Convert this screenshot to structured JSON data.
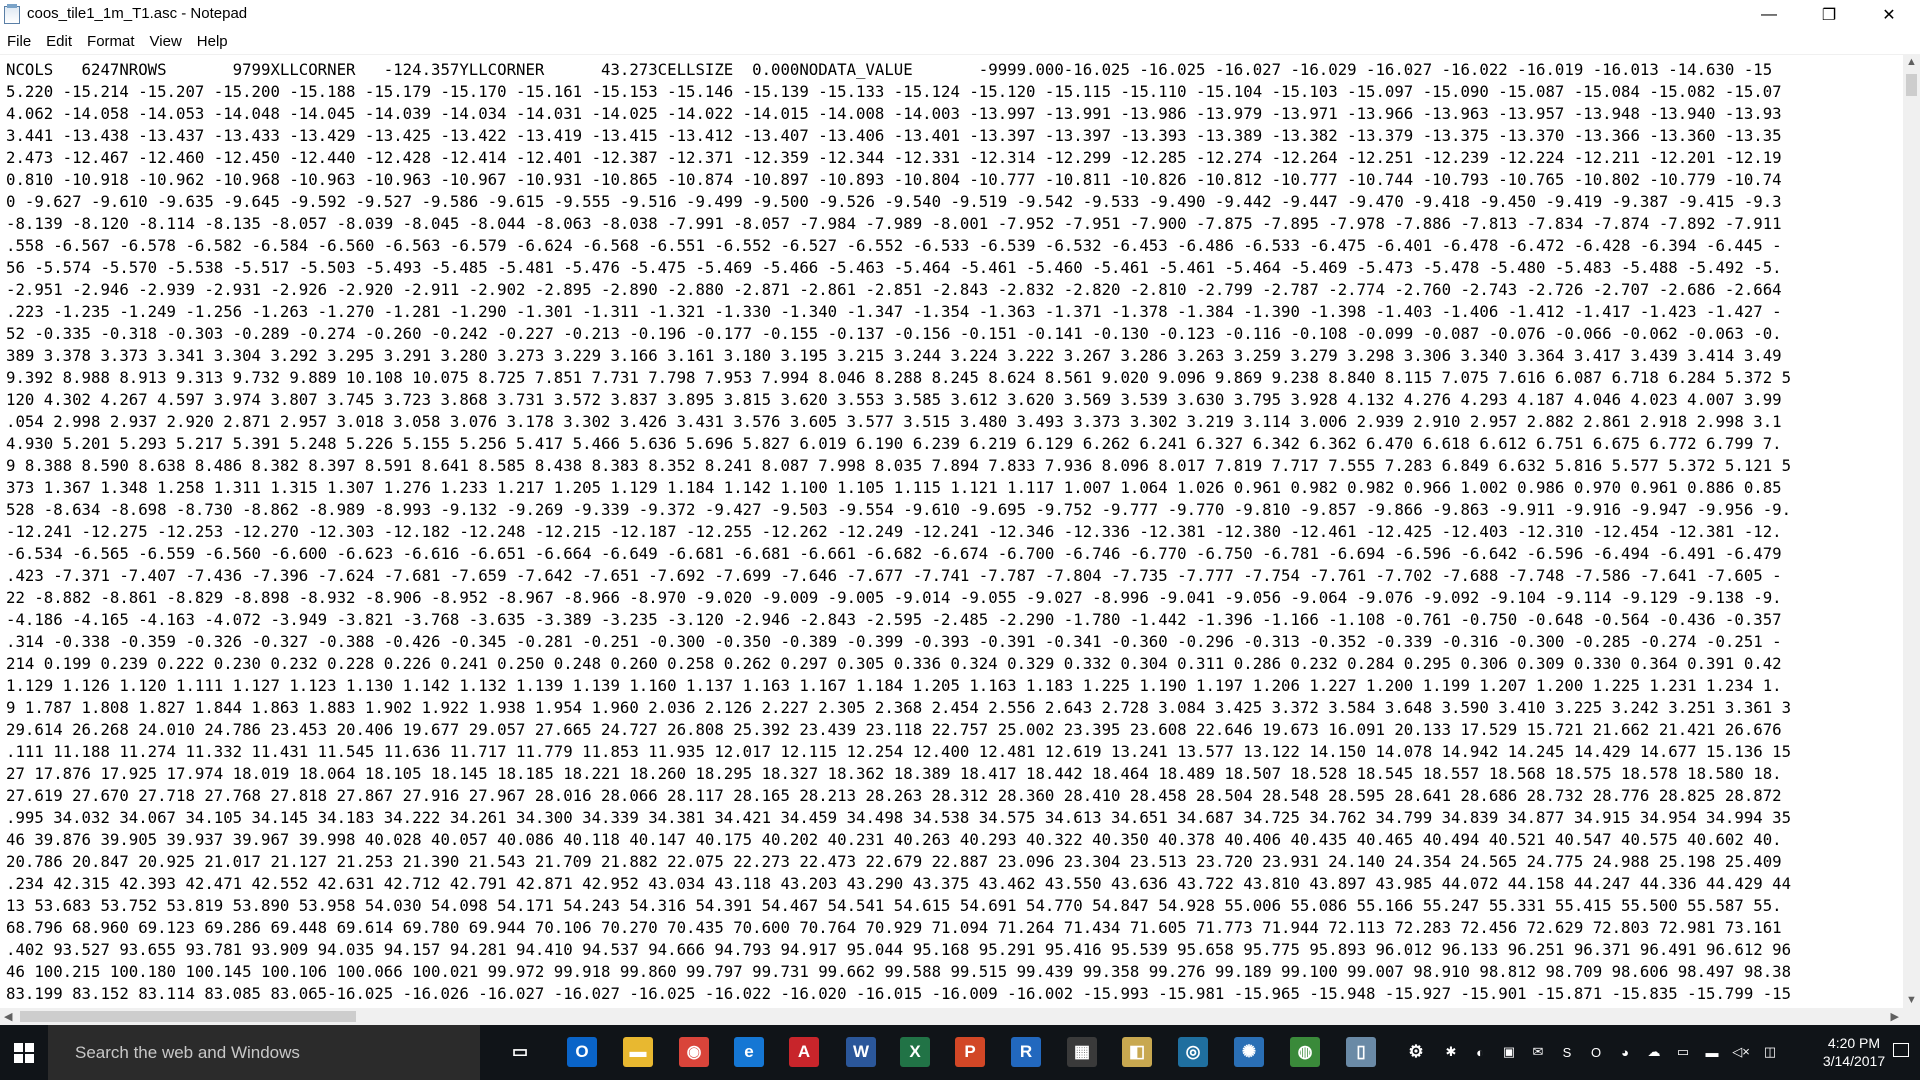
{
  "window": {
    "title": "coos_tile1_1m_T1.asc - Notepad",
    "minimize": "—",
    "maximize": "❐",
    "close": "✕"
  },
  "menu": [
    {
      "label": "File"
    },
    {
      "label": "Edit"
    },
    {
      "label": "Format"
    },
    {
      "label": "View"
    },
    {
      "label": "Help"
    }
  ],
  "content": {
    "lines": [
      "NCOLS   6247NROWS       9799XLLCORNER   -124.357YLLCORNER      43.273CELLSIZE  0.000NODATA_VALUE       -9999.000-16.025 -16.025 -16.027 -16.029 -16.027 -16.022 -16.019 -16.013 -14.630 -15",
      "5.220 -15.214 -15.207 -15.200 -15.188 -15.179 -15.170 -15.161 -15.153 -15.146 -15.139 -15.133 -15.124 -15.120 -15.115 -15.110 -15.104 -15.103 -15.097 -15.090 -15.087 -15.084 -15.082 -15.07",
      "4.062 -14.058 -14.053 -14.048 -14.045 -14.039 -14.034 -14.031 -14.025 -14.022 -14.015 -14.008 -14.003 -13.997 -13.991 -13.986 -13.979 -13.971 -13.966 -13.963 -13.957 -13.948 -13.940 -13.93",
      "3.441 -13.438 -13.437 -13.433 -13.429 -13.425 -13.422 -13.419 -13.415 -13.412 -13.407 -13.406 -13.401 -13.397 -13.397 -13.393 -13.389 -13.382 -13.379 -13.375 -13.370 -13.366 -13.360 -13.35",
      "2.473 -12.467 -12.460 -12.450 -12.440 -12.428 -12.414 -12.401 -12.387 -12.371 -12.359 -12.344 -12.331 -12.314 -12.299 -12.285 -12.274 -12.264 -12.251 -12.239 -12.224 -12.211 -12.201 -12.19",
      "0.810 -10.918 -10.962 -10.968 -10.963 -10.963 -10.967 -10.931 -10.865 -10.874 -10.897 -10.893 -10.804 -10.777 -10.811 -10.826 -10.812 -10.777 -10.744 -10.793 -10.765 -10.802 -10.779 -10.74",
      "0 -9.627 -9.610 -9.635 -9.645 -9.592 -9.527 -9.586 -9.615 -9.555 -9.516 -9.499 -9.500 -9.526 -9.540 -9.519 -9.542 -9.533 -9.490 -9.442 -9.447 -9.470 -9.418 -9.450 -9.419 -9.387 -9.415 -9.3",
      "-8.139 -8.120 -8.114 -8.135 -8.057 -8.039 -8.045 -8.044 -8.063 -8.038 -7.991 -8.057 -7.984 -7.989 -8.001 -7.952 -7.951 -7.900 -7.875 -7.895 -7.978 -7.886 -7.813 -7.834 -7.874 -7.892 -7.911",
      ".558 -6.567 -6.578 -6.582 -6.584 -6.560 -6.563 -6.579 -6.624 -6.568 -6.551 -6.552 -6.527 -6.552 -6.533 -6.539 -6.532 -6.453 -6.486 -6.533 -6.475 -6.401 -6.478 -6.472 -6.428 -6.394 -6.445 -",
      "56 -5.574 -5.570 -5.538 -5.517 -5.503 -5.493 -5.485 -5.481 -5.476 -5.475 -5.469 -5.466 -5.463 -5.464 -5.461 -5.460 -5.461 -5.461 -5.464 -5.469 -5.473 -5.478 -5.480 -5.483 -5.488 -5.492 -5.",
      "-2.951 -2.946 -2.939 -2.931 -2.926 -2.920 -2.911 -2.902 -2.895 -2.890 -2.880 -2.871 -2.861 -2.851 -2.843 -2.832 -2.820 -2.810 -2.799 -2.787 -2.774 -2.760 -2.743 -2.726 -2.707 -2.686 -2.664",
      ".223 -1.235 -1.249 -1.256 -1.263 -1.270 -1.281 -1.290 -1.301 -1.311 -1.321 -1.330 -1.340 -1.347 -1.354 -1.363 -1.371 -1.378 -1.384 -1.390 -1.398 -1.403 -1.406 -1.412 -1.417 -1.423 -1.427 -",
      "52 -0.335 -0.318 -0.303 -0.289 -0.274 -0.260 -0.242 -0.227 -0.213 -0.196 -0.177 -0.155 -0.137 -0.156 -0.151 -0.141 -0.130 -0.123 -0.116 -0.108 -0.099 -0.087 -0.076 -0.066 -0.062 -0.063 -0.",
      "389 3.378 3.373 3.341 3.304 3.292 3.295 3.291 3.280 3.273 3.229 3.166 3.161 3.180 3.195 3.215 3.244 3.224 3.222 3.267 3.286 3.263 3.259 3.279 3.298 3.306 3.340 3.364 3.417 3.439 3.414 3.49",
      "9.392 8.988 8.913 9.313 9.732 9.889 10.108 10.075 8.725 7.851 7.731 7.798 7.953 7.994 8.046 8.288 8.245 8.624 8.561 9.020 9.096 9.869 9.238 8.840 8.115 7.075 7.616 6.087 6.718 6.284 5.372 5",
      "120 4.302 4.267 4.597 3.974 3.807 3.745 3.723 3.868 3.731 3.572 3.837 3.895 3.815 3.620 3.553 3.585 3.612 3.620 3.569 3.539 3.630 3.795 3.928 4.132 4.276 4.293 4.187 4.046 4.023 4.007 3.99",
      ".054 2.998 2.937 2.920 2.871 2.957 3.018 3.058 3.076 3.178 3.302 3.426 3.431 3.576 3.605 3.577 3.515 3.480 3.493 3.373 3.302 3.219 3.114 3.006 2.939 2.910 2.957 2.882 2.861 2.918 2.998 3.1",
      "4.930 5.201 5.293 5.217 5.391 5.248 5.226 5.155 5.256 5.417 5.466 5.636 5.696 5.827 6.019 6.190 6.239 6.219 6.129 6.262 6.241 6.327 6.342 6.362 6.470 6.618 6.612 6.751 6.675 6.772 6.799 7.",
      "9 8.388 8.590 8.638 8.486 8.382 8.397 8.591 8.641 8.585 8.438 8.383 8.352 8.241 8.087 7.998 8.035 7.894 7.833 7.936 8.096 8.017 7.819 7.717 7.555 7.283 6.849 6.632 5.816 5.577 5.372 5.121 5",
      "373 1.367 1.348 1.258 1.311 1.315 1.307 1.276 1.233 1.217 1.205 1.129 1.184 1.142 1.100 1.105 1.115 1.121 1.117 1.007 1.064 1.026 0.961 0.982 0.982 0.966 1.002 0.986 0.970 0.961 0.886 0.85",
      "528 -8.634 -8.698 -8.730 -8.862 -8.989 -8.993 -9.132 -9.269 -9.339 -9.372 -9.427 -9.503 -9.554 -9.610 -9.695 -9.752 -9.777 -9.770 -9.810 -9.857 -9.866 -9.863 -9.911 -9.916 -9.947 -9.956 -9.",
      "-12.241 -12.275 -12.253 -12.270 -12.303 -12.182 -12.248 -12.215 -12.187 -12.255 -12.262 -12.249 -12.241 -12.346 -12.336 -12.381 -12.380 -12.461 -12.425 -12.403 -12.310 -12.454 -12.381 -12.",
      "-6.534 -6.565 -6.559 -6.560 -6.600 -6.623 -6.616 -6.651 -6.664 -6.649 -6.681 -6.681 -6.661 -6.682 -6.674 -6.700 -6.746 -6.770 -6.750 -6.781 -6.694 -6.596 -6.642 -6.596 -6.494 -6.491 -6.479",
      ".423 -7.371 -7.407 -7.436 -7.396 -7.624 -7.681 -7.659 -7.642 -7.651 -7.692 -7.699 -7.646 -7.677 -7.741 -7.787 -7.804 -7.735 -7.777 -7.754 -7.761 -7.702 -7.688 -7.748 -7.586 -7.641 -7.605 -",
      "22 -8.882 -8.861 -8.829 -8.898 -8.932 -8.906 -8.952 -8.967 -8.966 -8.970 -9.020 -9.009 -9.005 -9.014 -9.055 -9.027 -8.996 -9.041 -9.056 -9.064 -9.076 -9.092 -9.104 -9.114 -9.129 -9.138 -9.",
      "-4.186 -4.165 -4.163 -4.072 -3.949 -3.821 -3.768 -3.635 -3.389 -3.235 -3.120 -2.946 -2.843 -2.595 -2.485 -2.290 -1.780 -1.442 -1.396 -1.166 -1.108 -0.761 -0.750 -0.648 -0.564 -0.436 -0.357",
      ".314 -0.338 -0.359 -0.326 -0.327 -0.388 -0.426 -0.345 -0.281 -0.251 -0.300 -0.350 -0.389 -0.399 -0.393 -0.391 -0.341 -0.360 -0.296 -0.313 -0.352 -0.339 -0.316 -0.300 -0.285 -0.274 -0.251 -",
      "214 0.199 0.239 0.222 0.230 0.232 0.228 0.226 0.241 0.250 0.248 0.260 0.258 0.262 0.297 0.305 0.336 0.324 0.329 0.332 0.304 0.311 0.286 0.232 0.284 0.295 0.306 0.309 0.330 0.364 0.391 0.42",
      "1.129 1.126 1.120 1.111 1.127 1.123 1.130 1.142 1.132 1.139 1.139 1.160 1.137 1.163 1.167 1.184 1.205 1.163 1.183 1.225 1.190 1.197 1.206 1.227 1.200 1.199 1.207 1.200 1.225 1.231 1.234 1.",
      "9 1.787 1.808 1.827 1.844 1.863 1.883 1.902 1.922 1.938 1.954 1.960 2.036 2.126 2.227 2.305 2.368 2.454 2.556 2.643 2.728 3.084 3.425 3.372 3.584 3.648 3.590 3.410 3.225 3.242 3.251 3.361 3",
      "29.614 26.268 24.010 24.786 23.453 20.406 19.677 29.057 27.665 24.727 26.808 25.392 23.439 23.118 22.757 25.002 23.395 23.608 22.646 19.673 16.091 20.133 17.529 15.721 21.662 21.421 26.676",
      ".111 11.188 11.274 11.332 11.431 11.545 11.636 11.717 11.779 11.853 11.935 12.017 12.115 12.254 12.400 12.481 12.619 13.241 13.577 13.122 14.150 14.078 14.942 14.245 14.429 14.677 15.136 15",
      "27 17.876 17.925 17.974 18.019 18.064 18.105 18.145 18.185 18.221 18.260 18.295 18.327 18.362 18.389 18.417 18.442 18.464 18.489 18.507 18.528 18.545 18.557 18.568 18.575 18.578 18.580 18.",
      "27.619 27.670 27.718 27.768 27.818 27.867 27.916 27.967 28.016 28.066 28.117 28.165 28.213 28.263 28.312 28.360 28.410 28.458 28.504 28.548 28.595 28.641 28.686 28.732 28.776 28.825 28.872",
      ".995 34.032 34.067 34.105 34.145 34.183 34.222 34.261 34.300 34.339 34.381 34.421 34.459 34.498 34.538 34.575 34.613 34.651 34.687 34.725 34.762 34.799 34.839 34.877 34.915 34.954 34.994 35",
      "46 39.876 39.905 39.937 39.967 39.998 40.028 40.057 40.086 40.118 40.147 40.175 40.202 40.231 40.263 40.293 40.322 40.350 40.378 40.406 40.435 40.465 40.494 40.521 40.547 40.575 40.602 40.",
      "20.786 20.847 20.925 21.017 21.127 21.253 21.390 21.543 21.709 21.882 22.075 22.273 22.473 22.679 22.887 23.096 23.304 23.513 23.720 23.931 24.140 24.354 24.565 24.775 24.988 25.198 25.409",
      ".234 42.315 42.393 42.471 42.552 42.631 42.712 42.791 42.871 42.952 43.034 43.118 43.203 43.290 43.375 43.462 43.550 43.636 43.722 43.810 43.897 43.985 44.072 44.158 44.247 44.336 44.429 44",
      "13 53.683 53.752 53.819 53.890 53.958 54.030 54.098 54.171 54.243 54.316 54.391 54.467 54.541 54.615 54.691 54.770 54.847 54.928 55.006 55.086 55.166 55.247 55.331 55.415 55.500 55.587 55.",
      "68.796 68.960 69.123 69.286 69.448 69.614 69.780 69.944 70.106 70.270 70.435 70.600 70.764 70.929 71.094 71.264 71.434 71.605 71.773 71.944 72.113 72.283 72.456 72.629 72.803 72.981 73.161",
      ".402 93.527 93.655 93.781 93.909 94.035 94.157 94.281 94.410 94.537 94.666 94.793 94.917 95.044 95.168 95.291 95.416 95.539 95.658 95.775 95.893 96.012 96.133 96.251 96.371 96.491 96.612 96",
      "46 100.215 100.180 100.145 100.106 100.066 100.021 99.972 99.918 99.860 99.797 99.731 99.662 99.588 99.515 99.439 99.358 99.276 99.189 99.100 99.007 98.910 98.812 98.709 98.606 98.497 98.38",
      "83.199 83.152 83.114 83.085 83.065-16.025 -16.026 -16.027 -16.027 -16.025 -16.022 -16.020 -16.015 -16.009 -16.002 -15.993 -15.981 -15.965 -15.948 -15.927 -15.901 -15.871 -15.835 -15.799 -15"
    ]
  },
  "taskbar": {
    "search_placeholder": "Search the web and Windows",
    "apps": [
      {
        "name": "task-view-icon",
        "glyph": "▭",
        "color": "#101418"
      },
      {
        "name": "outlook-icon",
        "glyph": "O",
        "color": "#0a64c8"
      },
      {
        "name": "file-explorer-icon",
        "glyph": "▬",
        "color": "#e8b830"
      },
      {
        "name": "chrome-icon",
        "glyph": "◉",
        "color": "#d9443a"
      },
      {
        "name": "edge-icon",
        "glyph": "e",
        "color": "#1577d4"
      },
      {
        "name": "acrobat-icon",
        "glyph": "A",
        "color": "#c8252b"
      },
      {
        "name": "word-icon",
        "glyph": "W",
        "color": "#2b579a"
      },
      {
        "name": "excel-icon",
        "glyph": "X",
        "color": "#217346"
      },
      {
        "name": "powerpoint-icon",
        "glyph": "P",
        "color": "#d24726"
      },
      {
        "name": "r-icon",
        "glyph": "R",
        "color": "#2268be"
      },
      {
        "name": "calculator-icon",
        "glyph": "▦",
        "color": "#3a3a3a"
      },
      {
        "name": "folder-tool-icon",
        "glyph": "◧",
        "color": "#c8a850"
      },
      {
        "name": "globe-search-icon",
        "glyph": "◎",
        "color": "#1f6f9f"
      },
      {
        "name": "gear-globe-icon",
        "glyph": "✺",
        "color": "#2a6fb5"
      },
      {
        "name": "earth-icon",
        "glyph": "◍",
        "color": "#3a8a3a"
      },
      {
        "name": "notepad-icon",
        "glyph": "▯",
        "color": "#6a8aa6"
      },
      {
        "name": "settings-icon",
        "glyph": "⚙",
        "color": "#101418"
      }
    ],
    "tray": [
      {
        "name": "tray-yellow-icon",
        "glyph": "✱"
      },
      {
        "name": "tray-network-icon",
        "glyph": "◐"
      },
      {
        "name": "tray-nvidia-icon",
        "glyph": "▣"
      },
      {
        "name": "tray-mail-icon",
        "glyph": "✉"
      },
      {
        "name": "tray-skype-icon",
        "glyph": "S"
      },
      {
        "name": "tray-outlook-icon",
        "glyph": "O"
      },
      {
        "name": "tray-color-icon",
        "glyph": "◕"
      },
      {
        "name": "tray-cloud-icon",
        "glyph": "☁"
      },
      {
        "name": "tray-display-icon",
        "glyph": "▭"
      },
      {
        "name": "tray-battery-icon",
        "glyph": "▬"
      },
      {
        "name": "tray-volume-icon",
        "glyph": "◁×"
      },
      {
        "name": "tray-wifi-icon",
        "glyph": "◫"
      }
    ],
    "time": "4:20 PM",
    "date": "3/14/2017"
  }
}
